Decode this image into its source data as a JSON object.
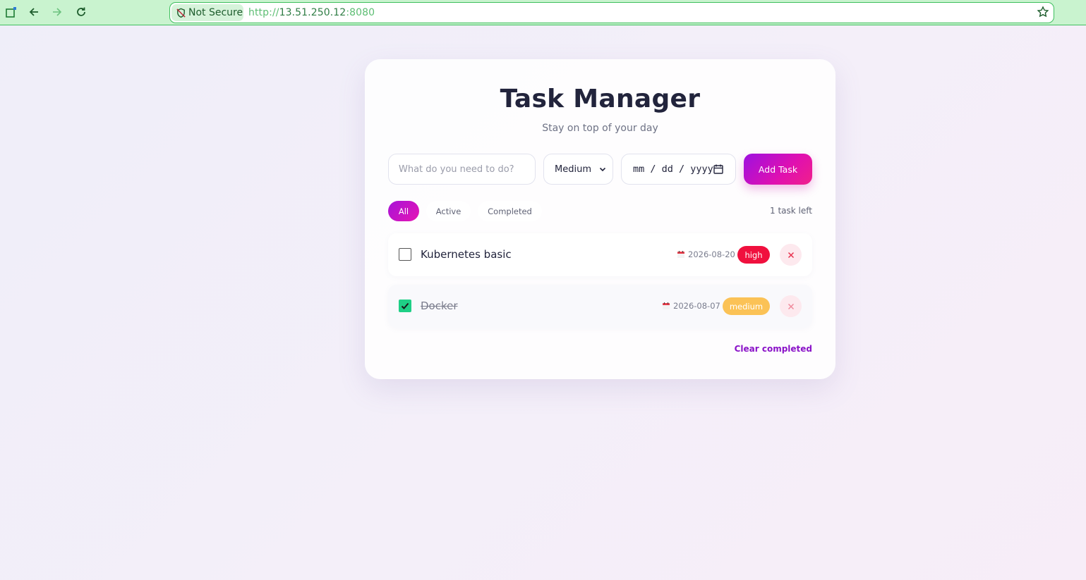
{
  "browser": {
    "security_label": "Not Secure",
    "url_scheme": "http://",
    "url_host": "13.51.250.12",
    "url_port": ":8080"
  },
  "app": {
    "title": "Task Manager",
    "subtitle": "Stay on top of your day"
  },
  "form": {
    "task_placeholder": "What do you need to do?",
    "priority_value": "Medium",
    "date_placeholder": "mm / dd / yyyy",
    "add_label": "Add Task"
  },
  "filters": {
    "all": "All",
    "active": "Active",
    "completed": "Completed",
    "selected": "All"
  },
  "count_label": "1 task left",
  "tasks": [
    {
      "text": "Kubernetes basic",
      "due": "2026-08-20",
      "priority": "high",
      "completed": false
    },
    {
      "text": "Docker",
      "due": "2026-08-07",
      "priority": "medium",
      "completed": true
    }
  ],
  "clear_label": "Clear completed",
  "colors": {
    "accent": "#b012d0",
    "high": "#f0103e",
    "medium": "#fbc256",
    "done_check": "#1fcf86"
  },
  "icons": [
    "browser-tab-icon",
    "back-arrow-icon",
    "forward-arrow-icon",
    "reload-icon",
    "not-secure-shield-icon",
    "bookmark-star-icon",
    "calendar-icon",
    "chevron-down-icon",
    "close-icon"
  ]
}
